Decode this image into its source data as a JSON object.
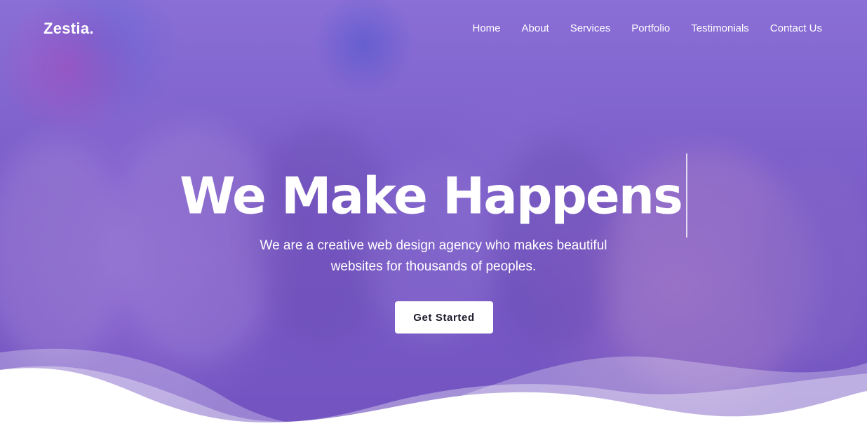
{
  "brand": {
    "name": "Zestia."
  },
  "nav": {
    "items": [
      {
        "label": "Home"
      },
      {
        "label": "About"
      },
      {
        "label": "Services"
      },
      {
        "label": "Portfolio"
      },
      {
        "label": "Testimonials"
      },
      {
        "label": "Contact Us"
      }
    ]
  },
  "hero": {
    "headline": "We Make Happens",
    "subtitle": "We are a creative web design agency who makes beautiful websites for thousands of peoples.",
    "cta_label": "Get Started"
  },
  "colors": {
    "overlay": "#7b5cc9",
    "text": "#ffffff",
    "button_bg": "#ffffff",
    "button_text": "#1d1b2c"
  },
  "icons": {
    "typing_cursor": "text-cursor-icon"
  }
}
